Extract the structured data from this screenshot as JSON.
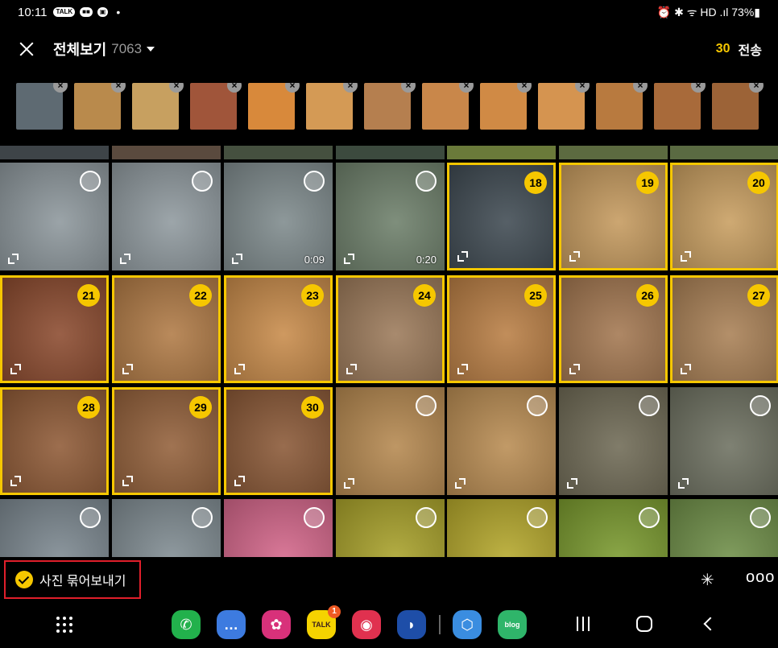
{
  "status_bar": {
    "time": "10:11",
    "left_badges": [
      "TALK",
      "■■",
      "▣"
    ],
    "right_text": "⏰ ✱ ᯤ HD .ıl 73%▮"
  },
  "header": {
    "title": "전체보기",
    "count": "7063",
    "selected_count": "30",
    "send_label": "전송"
  },
  "strip": [
    {
      "color": "#5e6a72"
    },
    {
      "color": "#b98a4c"
    },
    {
      "color": "#c7a060"
    },
    {
      "color": "#a0553a"
    },
    {
      "color": "#d8893b"
    },
    {
      "color": "#d49a55"
    },
    {
      "color": "#b57f4f"
    },
    {
      "color": "#c9874a"
    },
    {
      "color": "#d08a45"
    },
    {
      "color": "#d59450"
    },
    {
      "color": "#b87a3f"
    },
    {
      "color": "#a86a3a"
    },
    {
      "color": "#9c6337"
    }
  ],
  "grid": {
    "rows": [
      [
        {
          "color": "#8d979c",
          "selected": false,
          "number": "",
          "duration": ""
        },
        {
          "color": "#8f999e",
          "selected": false,
          "number": "",
          "duration": ""
        },
        {
          "color": "#7e8a8c",
          "selected": false,
          "number": "",
          "duration": "0:09"
        },
        {
          "color": "#6d7f6a",
          "selected": false,
          "number": "",
          "duration": "0:20"
        },
        {
          "color": "#3f4a52",
          "selected": true,
          "number": "18",
          "duration": ""
        },
        {
          "color": "#c59a5e",
          "selected": true,
          "number": "19",
          "duration": ""
        },
        {
          "color": "#c89e60",
          "selected": true,
          "number": "20",
          "duration": ""
        }
      ],
      [
        {
          "color": "#8b4a2e",
          "selected": true,
          "number": "21",
          "duration": ""
        },
        {
          "color": "#b07a45",
          "selected": true,
          "number": "22",
          "duration": ""
        },
        {
          "color": "#c88b4a",
          "selected": true,
          "number": "23",
          "duration": ""
        },
        {
          "color": "#9c7a5a",
          "selected": true,
          "number": "24",
          "duration": ""
        },
        {
          "color": "#b97e44",
          "selected": true,
          "number": "25",
          "duration": ""
        },
        {
          "color": "#a37750",
          "selected": true,
          "number": "26",
          "duration": ""
        },
        {
          "color": "#a98055",
          "selected": true,
          "number": "27",
          "duration": ""
        }
      ],
      [
        {
          "color": "#8f5a36",
          "selected": true,
          "number": "28",
          "duration": ""
        },
        {
          "color": "#93603a",
          "selected": true,
          "number": "29",
          "duration": ""
        },
        {
          "color": "#8a5836",
          "selected": true,
          "number": "30",
          "duration": ""
        },
        {
          "color": "#b5884f",
          "selected": false,
          "number": "",
          "duration": ""
        },
        {
          "color": "#b98c52",
          "selected": false,
          "number": "",
          "duration": ""
        },
        {
          "color": "#6f6a55",
          "selected": false,
          "number": "",
          "duration": ""
        },
        {
          "color": "#6d7060",
          "selected": false,
          "number": "",
          "duration": ""
        }
      ],
      [
        {
          "color": "#7c8890",
          "selected": false,
          "number": "",
          "duration": ""
        },
        {
          "color": "#808c92",
          "selected": false,
          "number": "",
          "duration": ""
        },
        {
          "color": "#d4668a",
          "selected": false,
          "number": "",
          "duration": ""
        },
        {
          "color": "#a9a22a",
          "selected": false,
          "number": "",
          "duration": ""
        },
        {
          "color": "#b5a82b",
          "selected": false,
          "number": "",
          "duration": ""
        },
        {
          "color": "#7a9a2e",
          "selected": false,
          "number": "",
          "duration": ""
        },
        {
          "color": "#6f8f48",
          "selected": false,
          "number": "",
          "duration": ""
        }
      ]
    ]
  },
  "bottom": {
    "bundle_label": "사진 묶어보내기",
    "sparkle_icon": "sparkle-icon",
    "more_label": "ooo"
  },
  "dock": {
    "apps": [
      {
        "name": "phone",
        "color": "#22b14c",
        "glyph": "✆",
        "badge": ""
      },
      {
        "name": "messages",
        "color": "#3d7be0",
        "glyph": "…",
        "badge": ""
      },
      {
        "name": "gallery",
        "color": "#d8317a",
        "glyph": "✿",
        "badge": ""
      },
      {
        "name": "kakaotalk",
        "color": "#f5d300",
        "glyph": "TALK",
        "badge": "1"
      },
      {
        "name": "camera",
        "color": "#e0314f",
        "glyph": "◉",
        "badge": ""
      },
      {
        "name": "linker",
        "color": "#1e4ea8",
        "glyph": "◗",
        "badge": ""
      },
      {
        "name": "secure-folder",
        "color": "#3a8de0",
        "glyph": "⬡",
        "badge": ""
      },
      {
        "name": "blog",
        "color": "#2fb56a",
        "glyph": "blog",
        "badge": ""
      }
    ]
  }
}
